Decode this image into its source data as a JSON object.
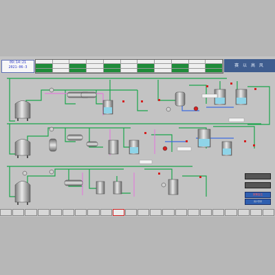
{
  "clock": {
    "time": "09:14:21",
    "date": "2021-06-3"
  },
  "header_grid": {
    "rows": [
      [
        "",
        "",
        "",
        "",
        "",
        "",
        "",
        "",
        "",
        "",
        ""
      ],
      [
        "",
        "",
        "",
        "",
        "",
        "",
        "",
        "",
        "",
        "",
        ""
      ],
      [
        "",
        "",
        "",
        "",
        "",
        "",
        "",
        "",
        "",
        "",
        ""
      ]
    ]
  },
  "logo": {
    "text": "赛 以 高 风"
  },
  "status_buttons": {
    "a": "",
    "b": ""
  },
  "alarm_button": {
    "label": "报警复位"
  },
  "login_button": {
    "label": "用户登录"
  },
  "tabs": [
    "",
    "",
    "",
    "",
    "",
    "",
    "",
    "",
    "",
    "",
    "",
    "",
    "",
    "",
    "",
    "",
    "",
    "",
    "",
    "",
    "",
    ""
  ],
  "active_tab_index": 9,
  "colors": {
    "pipe_green": "#18a54a",
    "pipe_pink": "#e07fd8",
    "pipe_blue": "#3c6be0",
    "valve_red": "#d42020",
    "accent": "#2f5fb0"
  },
  "process": {
    "tanks": 12,
    "pumps": 8,
    "heat_exchangers": 6
  }
}
